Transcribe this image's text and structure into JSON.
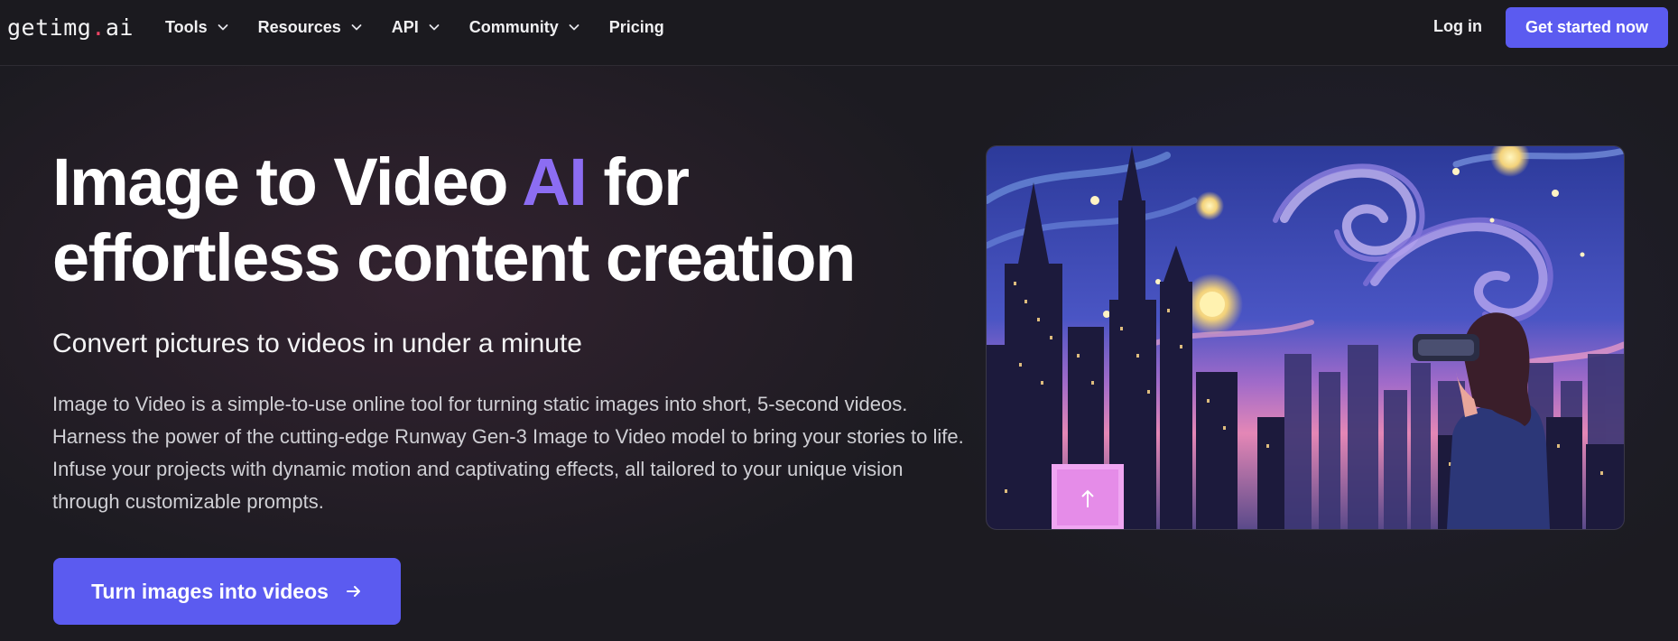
{
  "logo": {
    "text_a": "getimg",
    "dot": ".",
    "text_b": "ai"
  },
  "nav": {
    "items": [
      {
        "label": "Tools",
        "has_dropdown": true
      },
      {
        "label": "Resources",
        "has_dropdown": true
      },
      {
        "label": "API",
        "has_dropdown": true
      },
      {
        "label": "Community",
        "has_dropdown": true
      },
      {
        "label": "Pricing",
        "has_dropdown": false
      }
    ],
    "login_label": "Log in",
    "cta_label": "Get started now"
  },
  "hero": {
    "title_part1": "Image to Video ",
    "title_accent": "AI",
    "title_part2": " for effortless content creation",
    "subtitle": "Convert pictures to videos in under a minute",
    "description": "Image to Video is a simple-to-use online tool for turning static images into short, 5-second videos. Harness the power of the cutting-edge Runway Gen-3 Image to Video model to bring your stories to life. Infuse your projects with dynamic motion and captivating effects, all tailored to your unique vision through customizable prompts.",
    "cta_label": "Turn images into videos",
    "cta_icon": "arrow-right-icon"
  },
  "colors": {
    "accent": "#5b5bf0",
    "title_accent": "#8c6df2",
    "logo_dot": "#ef4565",
    "background": "#1c1b21"
  }
}
